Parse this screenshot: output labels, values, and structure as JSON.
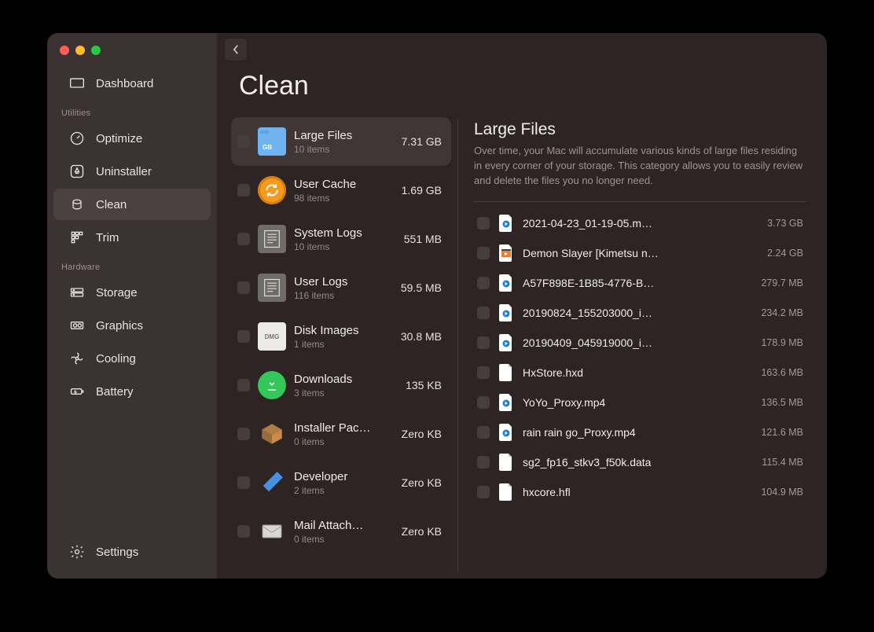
{
  "title": "Clean",
  "sidebar": {
    "top": {
      "label": "Dashboard"
    },
    "sections": [
      {
        "label": "Utilities",
        "items": [
          {
            "id": "optimize",
            "label": "Optimize",
            "icon": "gauge"
          },
          {
            "id": "uninstaller",
            "label": "Uninstaller",
            "icon": "appstore"
          },
          {
            "id": "clean",
            "label": "Clean",
            "icon": "trash",
            "active": true
          },
          {
            "id": "trim",
            "label": "Trim",
            "icon": "grid"
          }
        ]
      },
      {
        "label": "Hardware",
        "items": [
          {
            "id": "storage",
            "label": "Storage",
            "icon": "hdd"
          },
          {
            "id": "graphics",
            "label": "Graphics",
            "icon": "gpu"
          },
          {
            "id": "cooling",
            "label": "Cooling",
            "icon": "fan"
          },
          {
            "id": "battery",
            "label": "Battery",
            "icon": "battery"
          }
        ]
      }
    ],
    "settings": {
      "label": "Settings"
    }
  },
  "categories": [
    {
      "name": "Large Files",
      "sub": "10 items",
      "size": "7.31 GB",
      "icon": "folder",
      "color": "#6fb4f0",
      "selected": true
    },
    {
      "name": "User Cache",
      "sub": "98 items",
      "size": "1.69 GB",
      "icon": "cache",
      "color": "#f59a1f"
    },
    {
      "name": "System Logs",
      "sub": "10 items",
      "size": "551 MB",
      "icon": "syslog",
      "color": "#8d8986"
    },
    {
      "name": "User Logs",
      "sub": "116 items",
      "size": "59.5 MB",
      "icon": "ulog",
      "color": "#8d8986"
    },
    {
      "name": "Disk Images",
      "sub": "1 items",
      "size": "30.8 MB",
      "icon": "dmg",
      "color": "#e6e3e0"
    },
    {
      "name": "Downloads",
      "sub": "3 items",
      "size": "135 KB",
      "icon": "dl",
      "color": "#35c759"
    },
    {
      "name": "Installer Pac…",
      "sub": "0 items",
      "size": "Zero KB",
      "icon": "box",
      "color": "#c88b4a"
    },
    {
      "name": "Developer",
      "sub": "2 items",
      "size": "Zero KB",
      "icon": "hammer",
      "color": "#2f7de0"
    },
    {
      "name": "Mail Attach…",
      "sub": "0 items",
      "size": "Zero KB",
      "icon": "mail",
      "color": "#d9d6d4"
    }
  ],
  "detail": {
    "heading": "Large Files",
    "description": "Over time, your Mac will accumulate various kinds of large files residing in every corner of your storage. This category allows you to easily review and delete the files you no longer need.",
    "files": [
      {
        "name": "2021-04-23_01-19-05.m…",
        "size": "3.73 GB",
        "icon": "qt"
      },
      {
        "name": "Demon Slayer [Kimetsu n…",
        "size": "2.24 GB",
        "icon": "mkv"
      },
      {
        "name": "A57F898E-1B85-4776-B…",
        "size": "279.7 MB",
        "icon": "qt"
      },
      {
        "name": "20190824_155203000_i…",
        "size": "234.2 MB",
        "icon": "qt"
      },
      {
        "name": "20190409_045919000_i…",
        "size": "178.9 MB",
        "icon": "qt"
      },
      {
        "name": "HxStore.hxd",
        "size": "163.6 MB",
        "icon": "doc"
      },
      {
        "name": "YoYo_Proxy.mp4",
        "size": "136.5 MB",
        "icon": "qt"
      },
      {
        "name": "rain rain go_Proxy.mp4",
        "size": "121.6 MB",
        "icon": "qt"
      },
      {
        "name": "sg2_fp16_stkv3_f50k.data",
        "size": "115.4 MB",
        "icon": "doc"
      },
      {
        "name": "hxcore.hfl",
        "size": "104.9 MB",
        "icon": "doc"
      }
    ]
  }
}
